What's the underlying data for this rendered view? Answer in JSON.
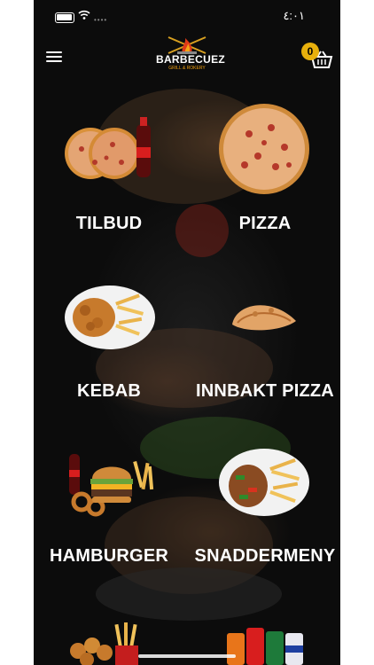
{
  "status_bar": {
    "time": "٤:٠١"
  },
  "header": {
    "logo_text": "BARBECUEZ",
    "logo_subtext": "GRILL & ROKERY",
    "cart_count": "0"
  },
  "categories": [
    {
      "label": "TILBUD"
    },
    {
      "label": "PIZZA"
    },
    {
      "label": "KEBAB"
    },
    {
      "label": "INNBAKT PIZZA"
    },
    {
      "label": "HAMBURGER"
    },
    {
      "label": "SNADDERMENY"
    }
  ],
  "icons": {
    "menu": "hamburger-menu-icon",
    "cart": "basket-icon"
  },
  "colors": {
    "background": "#0c0c0c",
    "badge": "#e8b00c",
    "label": "#ffffff"
  }
}
